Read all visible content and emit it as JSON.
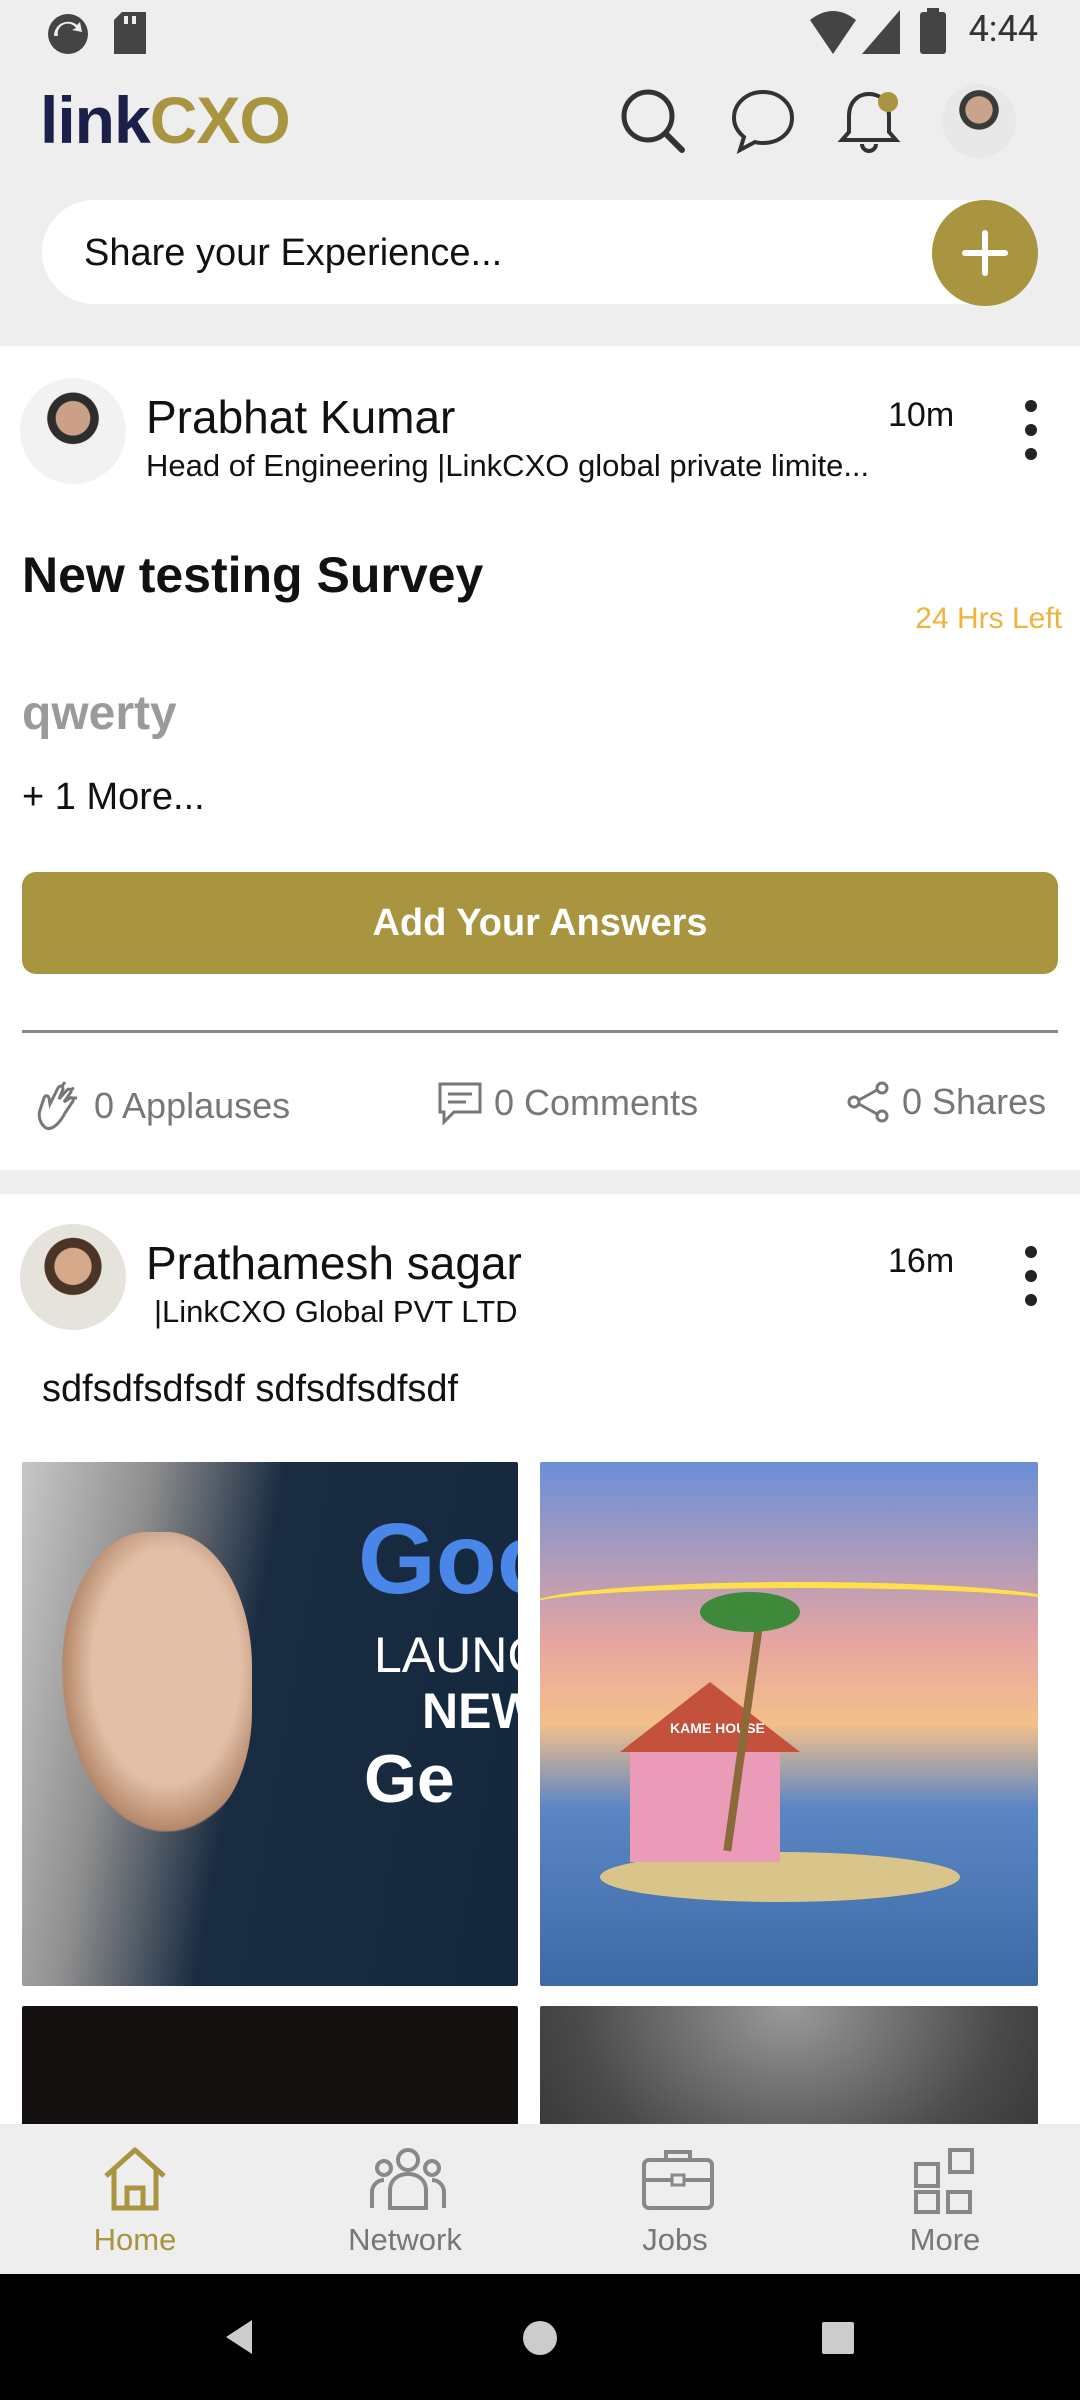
{
  "status_bar": {
    "time": "4:44"
  },
  "header": {
    "logo_part1": "link",
    "logo_part2": "CXO"
  },
  "share": {
    "placeholder": "Share your Experience..."
  },
  "posts": [
    {
      "author": "Prabhat Kumar",
      "subtitle": "Head of Engineering |LinkCXO global private limite...",
      "time": "10m",
      "survey_title": "New testing Survey",
      "time_left": "24 Hrs Left",
      "question": "qwerty",
      "more": "+ 1 More...",
      "button": "Add Your Answers",
      "applauses": "0 Applauses",
      "comments": "0 Comments",
      "shares": "0 Shares"
    },
    {
      "author": "Prathamesh sagar",
      "subtitle": "|LinkCXO Global PVT LTD",
      "time": "16m",
      "text": "sdfsdfsdfsdf sdfsdfsdfsdf",
      "image1_text": [
        "Goo",
        "LAUNC",
        "NEW",
        "Ge"
      ],
      "image2_text": "KAME HOUSE"
    }
  ],
  "bottom_nav": [
    {
      "label": "Home",
      "icon": "home-icon",
      "active": true
    },
    {
      "label": "Network",
      "icon": "network-icon",
      "active": false
    },
    {
      "label": "Jobs",
      "icon": "briefcase-icon",
      "active": false
    },
    {
      "label": "More",
      "icon": "grid-icon",
      "active": false
    }
  ],
  "colors": {
    "accent": "#a99440",
    "brand_dark": "#1b1f4a",
    "warning": "#f0b23c"
  }
}
